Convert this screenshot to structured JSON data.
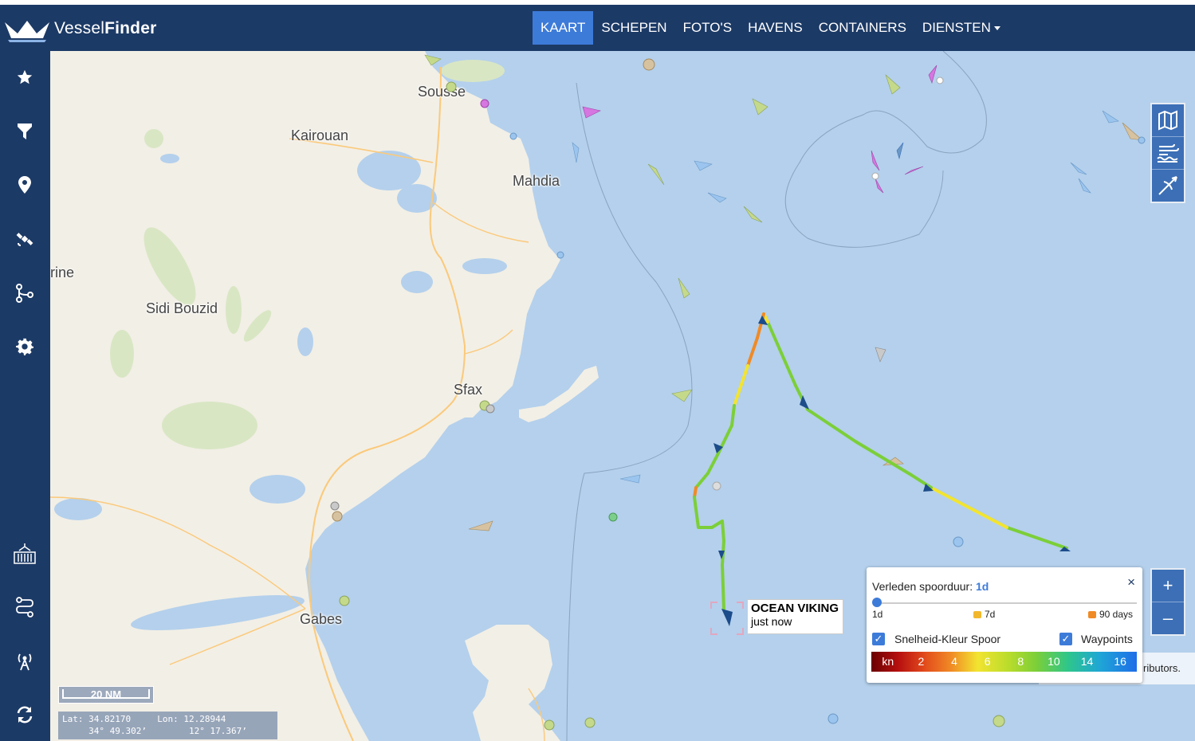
{
  "app": {
    "brand_prefix": "Vessel",
    "brand_suffix": "Finder"
  },
  "nav": {
    "items": [
      "KAART",
      "SCHEPEN",
      "FOTO'S",
      "HAVENS",
      "CONTAINERS",
      "DIENSTEN"
    ],
    "active": "KAART"
  },
  "sidebar": {
    "top_icons": [
      "star-icon",
      "filter-icon",
      "map-pin-icon",
      "satellite-icon",
      "route-icon",
      "gear-icon"
    ],
    "bottom_icons": [
      "port-icon",
      "track-route-icon",
      "antenna-icon",
      "refresh-icon"
    ]
  },
  "places": {
    "sousse": "Sousse",
    "kairouan": "Kairouan",
    "mahdia": "Mahdia",
    "rine": "rine",
    "sidi_bouzid": "Sidi Bouzid",
    "sfax": "Sfax",
    "gabes": "Gabes"
  },
  "ship": {
    "name": "OCEAN VIKING",
    "updated": "just now"
  },
  "track_panel": {
    "title": "Verleden spoorduur:",
    "value": "1d",
    "ticks": [
      "1d",
      "7d",
      "90 days"
    ],
    "speed_color_label": "Snelheid-Kleur Spoor",
    "waypoints_label": "Waypoints",
    "speed_color_checked": true,
    "waypoints_checked": true,
    "scale_unit": "kn",
    "scale_values": [
      "2",
      "4",
      "6",
      "8",
      "10",
      "14",
      "16"
    ],
    "close": "×"
  },
  "attribution": "ributors.",
  "scale_bar": "20 NM",
  "coordinates": {
    "lat_label": "Lat:",
    "lat_decimal": "34.82170",
    "lat_dms": "34° 49.302’",
    "lon_label": "Lon:",
    "lon_decimal": "12.28944",
    "lon_dms": "12° 17.367’"
  },
  "zoom": {
    "in": "+",
    "out": "–"
  },
  "colors": {
    "navbar": "#1c3a66",
    "active_tab": "#3d7bd9",
    "sea": "#b4d0ec",
    "land": "#f2efe6",
    "track_green": "#7ccf38",
    "track_yellow": "#f2e430",
    "track_orange": "#f08a25"
  }
}
